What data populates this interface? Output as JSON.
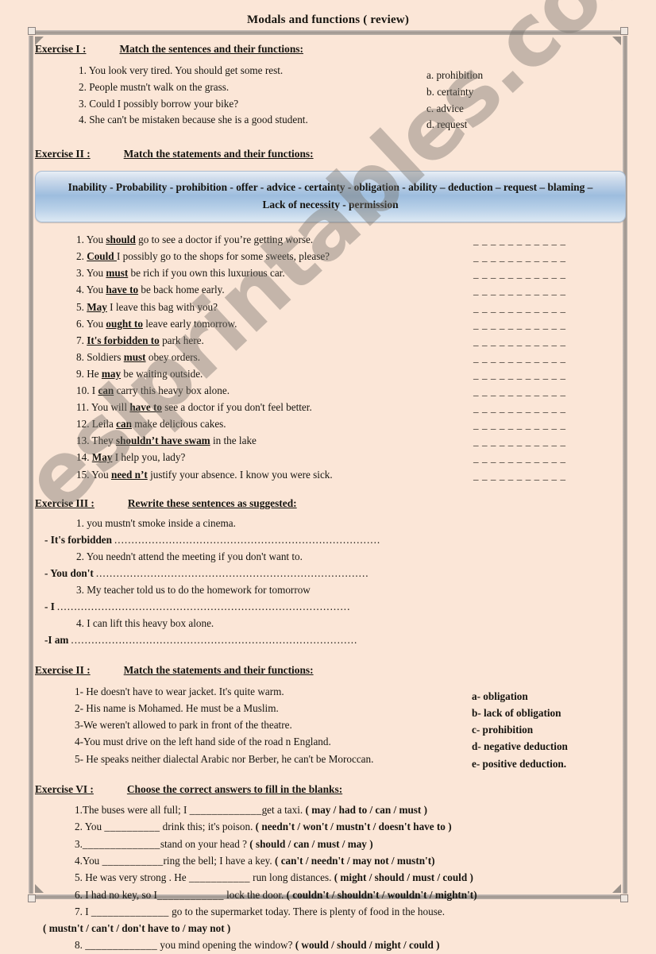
{
  "document": {
    "title": "Modals and functions ( review)",
    "watermark": "eslprintables.com",
    "background_color": "#fbe6d7",
    "banner_accent_color": "#9dbdde"
  },
  "exercise1": {
    "label": "Exercise I :",
    "instruction": "Match the sentences and their functions:",
    "items": [
      "1. You look very tired. You should get some rest.",
      "2. People mustn't walk on the grass.",
      "3. Could I possibly borrow your bike?",
      "4. She can't be mistaken because she is a good student."
    ],
    "options": [
      "a. prohibition",
      "b. certainty",
      "c. advice",
      "d. request"
    ]
  },
  "exercise2": {
    "label": "Exercise II :",
    "instruction": "Match the statements and their functions:",
    "wordbank_line1": "Inability - Probability - prohibition  - offer - advice  - certainty - obligation - ability – deduction – request  – blaming –",
    "wordbank_line2": "Lack of necessity - permission",
    "items": [
      {
        "num": "1.",
        "pre": "You ",
        "modal": "should",
        "post": " go to see a doctor if you’re getting worse."
      },
      {
        "num": "2.",
        "pre": "",
        "modal": "Could ",
        "post": " I possibly go to the shops for some sweets, please?"
      },
      {
        "num": "3.",
        "pre": "You ",
        "modal": "must",
        "post": " be rich if you own this luxurious car."
      },
      {
        "num": "4.",
        "pre": "You ",
        "modal": "have to",
        "post": " be back home early."
      },
      {
        "num": "5.",
        "pre": "",
        "modal": "May",
        "post": " I leave this bag with you?"
      },
      {
        "num": "6.",
        "pre": "You ",
        "modal": "ought to",
        "post": " leave early tomorrow."
      },
      {
        "num": "7.",
        "pre": "",
        "modal": "It's forbidden to",
        "post": " park here."
      },
      {
        "num": "8.",
        "pre": "Soldiers ",
        "modal": "must",
        "post": " obey orders."
      },
      {
        "num": "9.",
        "pre": "He ",
        "modal": "may",
        "post": " be waiting outside."
      },
      {
        "num": "10.",
        "pre": "I ",
        "modal": "can",
        "post": " carry this heavy box alone."
      },
      {
        "num": "11.",
        "pre": "You will ",
        "modal": "have to",
        "post": " see a doctor if you don't feel better."
      },
      {
        "num": "12.",
        "pre": "Leila ",
        "modal": "can",
        "post": " make delicious cakes."
      },
      {
        "num": "13.",
        "pre": "They ",
        "modal": "shouldn’t have swam",
        "post": " in the lake"
      },
      {
        "num": "14.",
        "pre": "",
        "modal": "May",
        "post": " I help you, lady?"
      },
      {
        "num": "15.",
        "pre": "You ",
        "modal": "need n’t",
        "post": " justify your absence. I know you were sick."
      }
    ],
    "blank": "_ _ _ _ _ _ _ _ _ _ _"
  },
  "exercise3": {
    "label": "Exercise III :",
    "instruction": "Rewrite these sentences as suggested:",
    "items": [
      {
        "question": "1. you mustn't smoke inside a cinema.",
        "stem": "- It's forbidden",
        "dots_len": 78
      },
      {
        "question": "2. You needn't attend the meeting if you don't want to.",
        "stem": "- You don't",
        "dots_len": 80
      },
      {
        "question": "3. My teacher told us to do the homework for tomorrow",
        "stem": "- I",
        "dots_len": 86
      },
      {
        "question": "4. I can lift this heavy box alone.",
        "stem": "-I am",
        "dots_len": 84
      }
    ]
  },
  "exercise2b": {
    "label": "Exercise II :",
    "instruction": "Match the statements and their functions:",
    "items": [
      "1- He doesn't have to wear jacket. It's quite warm.",
      "2- His name is Mohamed. He must be a Muslim.",
      "3-We weren't allowed to park in front of the theatre.",
      "4-You must drive on the left hand side of the road n England.",
      "5- He speaks neither dialectal Arabic nor Berber, he can't be Moroccan."
    ],
    "options": [
      "a-  obligation",
      "b-  lack of obligation",
      "c-  prohibition",
      "d-  negative deduction",
      "e-  positive deduction."
    ]
  },
  "exercise6": {
    "label": "Exercise VI :",
    "instruction": "Choose the correct answers to fill in the blanks:",
    "items": [
      {
        "pre": "1.The buses were all full; I ",
        "gap": "_____________",
        "mid": "get a taxi.  ",
        "choices": "( may / had to / can / must )",
        "indent": true
      },
      {
        "pre": "2. You ",
        "gap": "__________",
        "mid": " drink this; it's poison.  ",
        "choices": "( needn't / won't / mustn't / doesn't have to )",
        "indent": true
      },
      {
        "pre": "3.",
        "gap": "______________",
        "mid": "stand on your head ?   ",
        "choices": "( should / can / must / may )",
        "indent": true
      },
      {
        "pre": "4.You ",
        "gap": "___________",
        "mid": "ring the bell; I have a key.   ",
        "choices": "( can't / needn't / may not / mustn't)",
        "indent": true
      },
      {
        "pre": "5. He was very strong . He ",
        "gap": "___________",
        "mid": " run long distances.  ",
        "choices": "( might / should / must / could )",
        "indent": true
      },
      {
        "pre": "6. I had no key, so I",
        "gap": "____________",
        "mid": " lock the door.     ",
        "choices": "( couldn't / shouldn't / wouldn't / mightn't)",
        "indent": true
      },
      {
        "pre": "7. I ",
        "gap": "______________",
        "mid": " go to the supermarket today. There is plenty of food in the house.",
        "choices": "",
        "indent": true
      },
      {
        "pre": "",
        "gap": "",
        "mid": "",
        "choices": "( mustn't / can't / don't have to / may not )",
        "indent": false
      },
      {
        "pre": "8. ",
        "gap": "_____________",
        "mid": " you mind opening the window?  ",
        "choices": "( would / should / might / could )",
        "indent": true
      }
    ]
  }
}
